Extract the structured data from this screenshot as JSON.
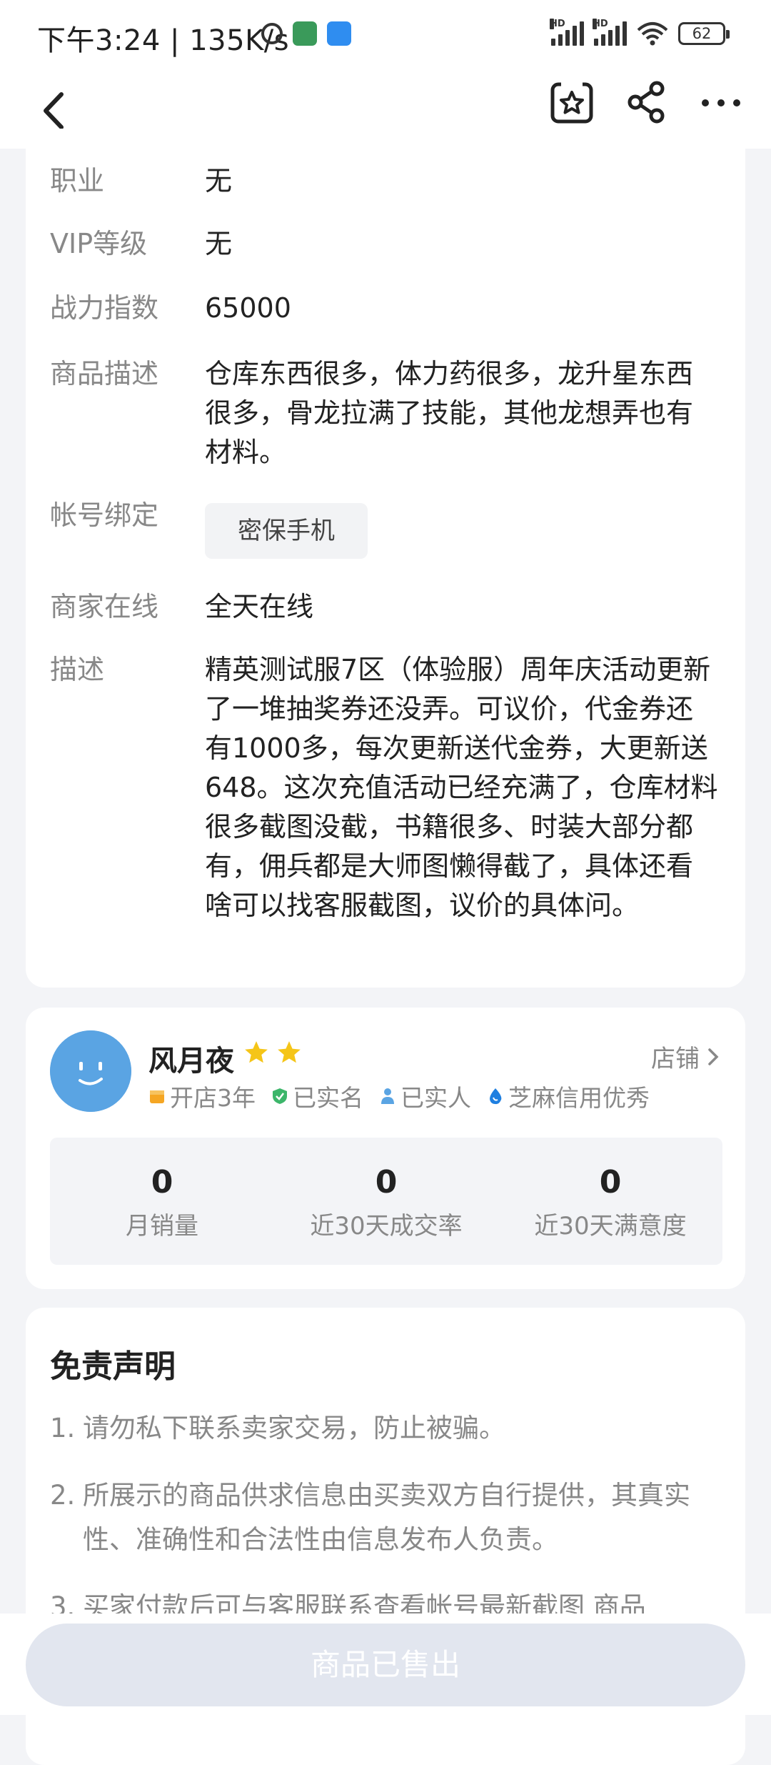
{
  "status_bar": {
    "time": "下午3:24 | 135K/s",
    "battery": "62",
    "network_type": "HD"
  },
  "info": {
    "rows": [
      {
        "label": "职业",
        "value": "无"
      },
      {
        "label": "VIP等级",
        "value": "无"
      },
      {
        "label": "战力指数",
        "value": "65000"
      },
      {
        "label": "商品描述",
        "value": "仓库东西很多，体力药很多，龙升星东西很多，骨龙拉满了技能，其他龙想弄也有材料。"
      },
      {
        "label": "帐号绑定",
        "value": "密保手机"
      },
      {
        "label": "商家在线",
        "value": "全天在线"
      },
      {
        "label": "描述",
        "value": "精英测试服7区（体验服）周年庆活动更新了一堆抽奖券还没弄。可议价，代金券还有1000多，每次更新送代金券，大更新送648。这次充值活动已经充满了，仓库材料很多截图没截，书籍很多、时装大部分都有，佣兵都是大师图懒得截了，具体还看啥可以找客服截图，议价的具体问。"
      }
    ]
  },
  "seller": {
    "name": "风月夜",
    "shop_label": "店铺",
    "badges": [
      {
        "label": "开店3年",
        "icon": "shop-badge-icon",
        "color": "#f5a623"
      },
      {
        "label": "已实名",
        "icon": "verified-shield-icon",
        "color": "#3cb66a"
      },
      {
        "label": "已实人",
        "icon": "person-verified-icon",
        "color": "#5aa4e3"
      },
      {
        "label": "芝麻信用优秀",
        "icon": "sesame-credit-icon",
        "color": "#1f7fe0"
      }
    ],
    "stats": [
      {
        "value": "0",
        "label": "月销量"
      },
      {
        "value": "0",
        "label": "近30天成交率"
      },
      {
        "value": "0",
        "label": "近30天满意度"
      }
    ]
  },
  "disclaimer": {
    "title": "免责声明",
    "items": [
      {
        "num": "1.",
        "text": "请勿私下联系卖家交易，防止被骗。"
      },
      {
        "num": "2.",
        "text": "所展示的商品供求信息由买卖双方自行提供，其真实性、准确性和合法性由信息发布人负责。"
      },
      {
        "num": "3.",
        "text": "买家付款后可与客服联系查看帐号最新截图 商品"
      }
    ]
  },
  "bottom": {
    "sold_label": "商品已售出"
  },
  "colors": {
    "accent_blue": "#5aa4e3",
    "star": "#f5c518",
    "sold_button_bg": "#e2e6ef"
  }
}
